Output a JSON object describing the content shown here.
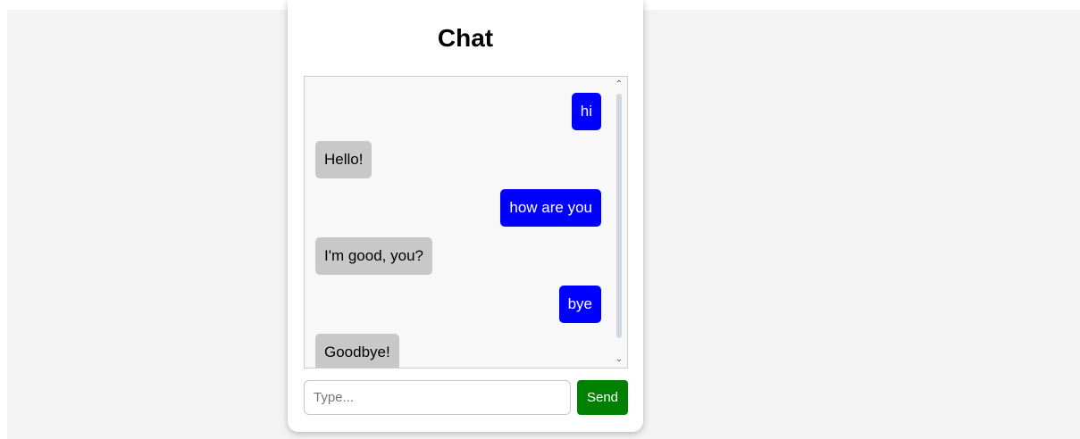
{
  "chat": {
    "title": "Chat",
    "messages": [
      {
        "role": "user",
        "text": "hi"
      },
      {
        "role": "bot",
        "text": "Hello!"
      },
      {
        "role": "user",
        "text": "how are you"
      },
      {
        "role": "bot",
        "text": "I'm good, you?"
      },
      {
        "role": "user",
        "text": "bye"
      },
      {
        "role": "bot",
        "text": "Goodbye!"
      }
    ],
    "scrollbar": {
      "up_icon": "chevron-up-icon",
      "down_icon": "chevron-down-icon"
    }
  },
  "composer": {
    "placeholder": "Type...",
    "value": "",
    "send_label": "Send"
  },
  "colors": {
    "user_bubble": "#0000ff",
    "bot_bubble": "#c8c8c8",
    "send_button": "#008000",
    "page_background": "#f3f3f3"
  }
}
